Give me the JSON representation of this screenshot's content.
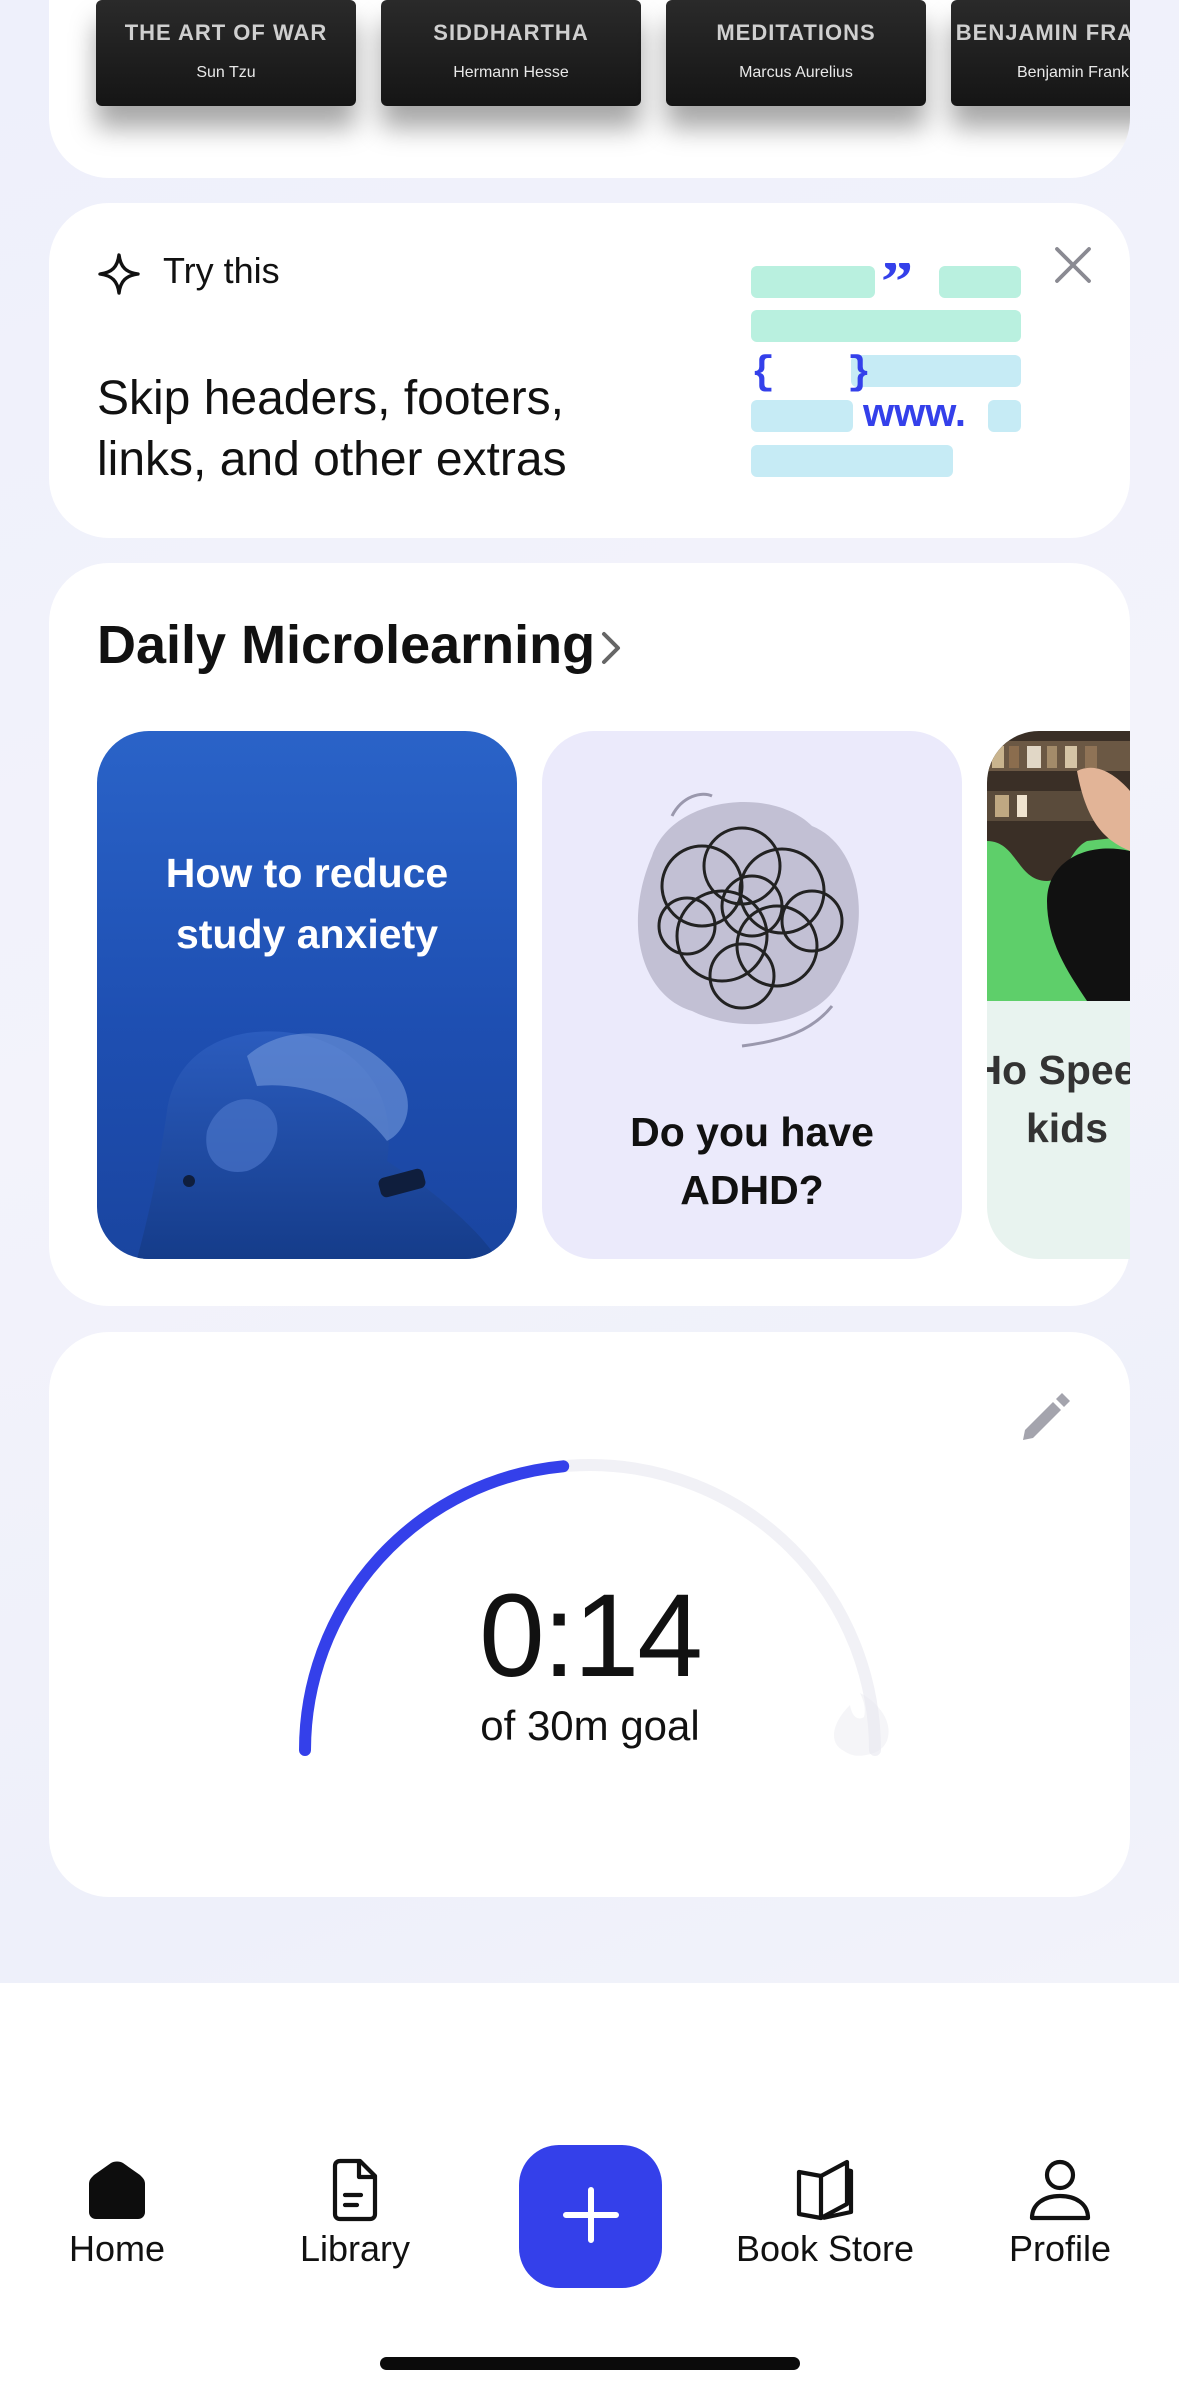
{
  "books": [
    {
      "title": "THE ART OF WAR",
      "author": "Sun Tzu"
    },
    {
      "title": "SIDDHARTHA",
      "author": "Hermann Hesse"
    },
    {
      "title": "MEDITATIONS",
      "author": "Marcus Aurelius"
    },
    {
      "title": "BENJAMIN FRANKLIN",
      "author": "Benjamin Franklin"
    }
  ],
  "try_this": {
    "label": "Try this",
    "tip": "Skip headers, footers, links, and other extras",
    "illustration": {
      "quote": "”",
      "braces": "{   }",
      "www": "www."
    }
  },
  "daily": {
    "title": "Daily Microlearning",
    "cards": [
      {
        "title": "How to reduce study anxiety"
      },
      {
        "title": "Do you have ADHD?"
      },
      {
        "title": "Ho Speed kids"
      }
    ]
  },
  "goal": {
    "time": "0:14",
    "goal_text": "of 30m goal",
    "progress_fraction": 0.47
  },
  "nav": {
    "home": "Home",
    "library": "Library",
    "bookstore": "Book Store",
    "profile": "Profile"
  },
  "colors": {
    "accent": "#3440ea",
    "gauge_track": "#f1f1f6",
    "mint": "#b9f0df",
    "sky": "#c6ebf5"
  }
}
